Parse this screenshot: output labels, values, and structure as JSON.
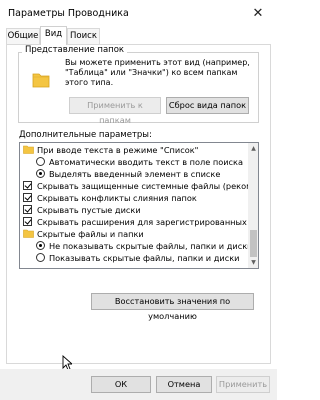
{
  "window": {
    "title": "Параметры Проводника",
    "close_glyph": "✕"
  },
  "tabs": [
    {
      "label": "Общие",
      "active": false
    },
    {
      "label": "Вид",
      "active": true
    },
    {
      "label": "Поиск",
      "active": false
    }
  ],
  "folder_views": {
    "title": "Представление папок",
    "description_lines": [
      "Вы можете применить этот вид (например,",
      "\"Таблица\" или \"Значки\") ко всем папкам",
      "этого типа."
    ],
    "apply_button": "Применить к папкам",
    "reset_button": "Сброс вида папок"
  },
  "advanced": {
    "label": "Дополнительные параметры:",
    "items": [
      {
        "type": "folder",
        "level": 1,
        "label": "При вводе текста в режиме \"Список\""
      },
      {
        "type": "radio",
        "level": 2,
        "checked": false,
        "label": "Автоматически вводить текст в поле поиска"
      },
      {
        "type": "radio",
        "level": 2,
        "checked": true,
        "label": "Выделять введенный элемент в списке"
      },
      {
        "type": "checkbox",
        "level": 1,
        "checked": true,
        "label": "Скрывать защищенные системные файлы (рекомен"
      },
      {
        "type": "checkbox",
        "level": 1,
        "checked": true,
        "label": "Скрывать конфликты слияния папок"
      },
      {
        "type": "checkbox",
        "level": 1,
        "checked": true,
        "label": "Скрывать пустые диски"
      },
      {
        "type": "checkbox",
        "level": 1,
        "checked": true,
        "label": "Скрывать расширения для зарегистрированных типо"
      },
      {
        "type": "folder",
        "level": 1,
        "label": "Скрытые файлы и папки"
      },
      {
        "type": "radio",
        "level": 2,
        "checked": true,
        "label": "Не показывать скрытые файлы, папки и диски"
      },
      {
        "type": "radio",
        "level": 2,
        "checked": false,
        "label": "Показывать скрытые файлы, папки и диски"
      }
    ],
    "restore_button": "Восстановить значения по умолчанию"
  },
  "footer": {
    "ok": "ОК",
    "cancel": "Отмена",
    "apply": "Применить"
  },
  "colors": {
    "accent": "#0078d7",
    "folder": "#f4c542"
  }
}
